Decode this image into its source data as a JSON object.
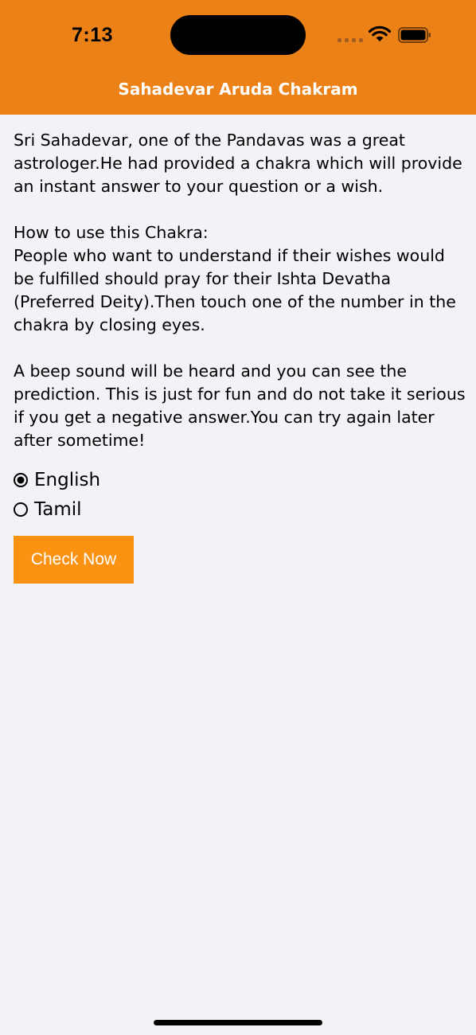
{
  "status_bar": {
    "time": "7:13",
    "signal_icon": "cellular-signal-icon",
    "wifi_icon": "wifi-icon",
    "battery_icon": "battery-icon"
  },
  "navbar": {
    "title": "Sahadevar Aruda Chakram",
    "background_color": "#ec8117"
  },
  "content": {
    "intro": "Sri Sahadevar, one of the Pandavas was a great astrologer.He had provided a chakra which will provide an instant answer to your question or a wish.",
    "how_to_heading": "How to use this Chakra:",
    "how_to_body": "People who want to understand if their wishes would be fulfilled should pray for their Ishta Devatha (Preferred Deity).Then touch one of the number in the chakra by closing eyes.",
    "disclaimer": "A beep sound will be heard and you can see the prediction. This is just for fun and do not take it serious if you get a negative answer.You can try again later after sometime!"
  },
  "language": {
    "options": [
      {
        "label": "English",
        "selected": true
      },
      {
        "label": "Tamil",
        "selected": false
      }
    ]
  },
  "actions": {
    "check_now_label": "Check Now",
    "button_color": "#fc9212"
  }
}
